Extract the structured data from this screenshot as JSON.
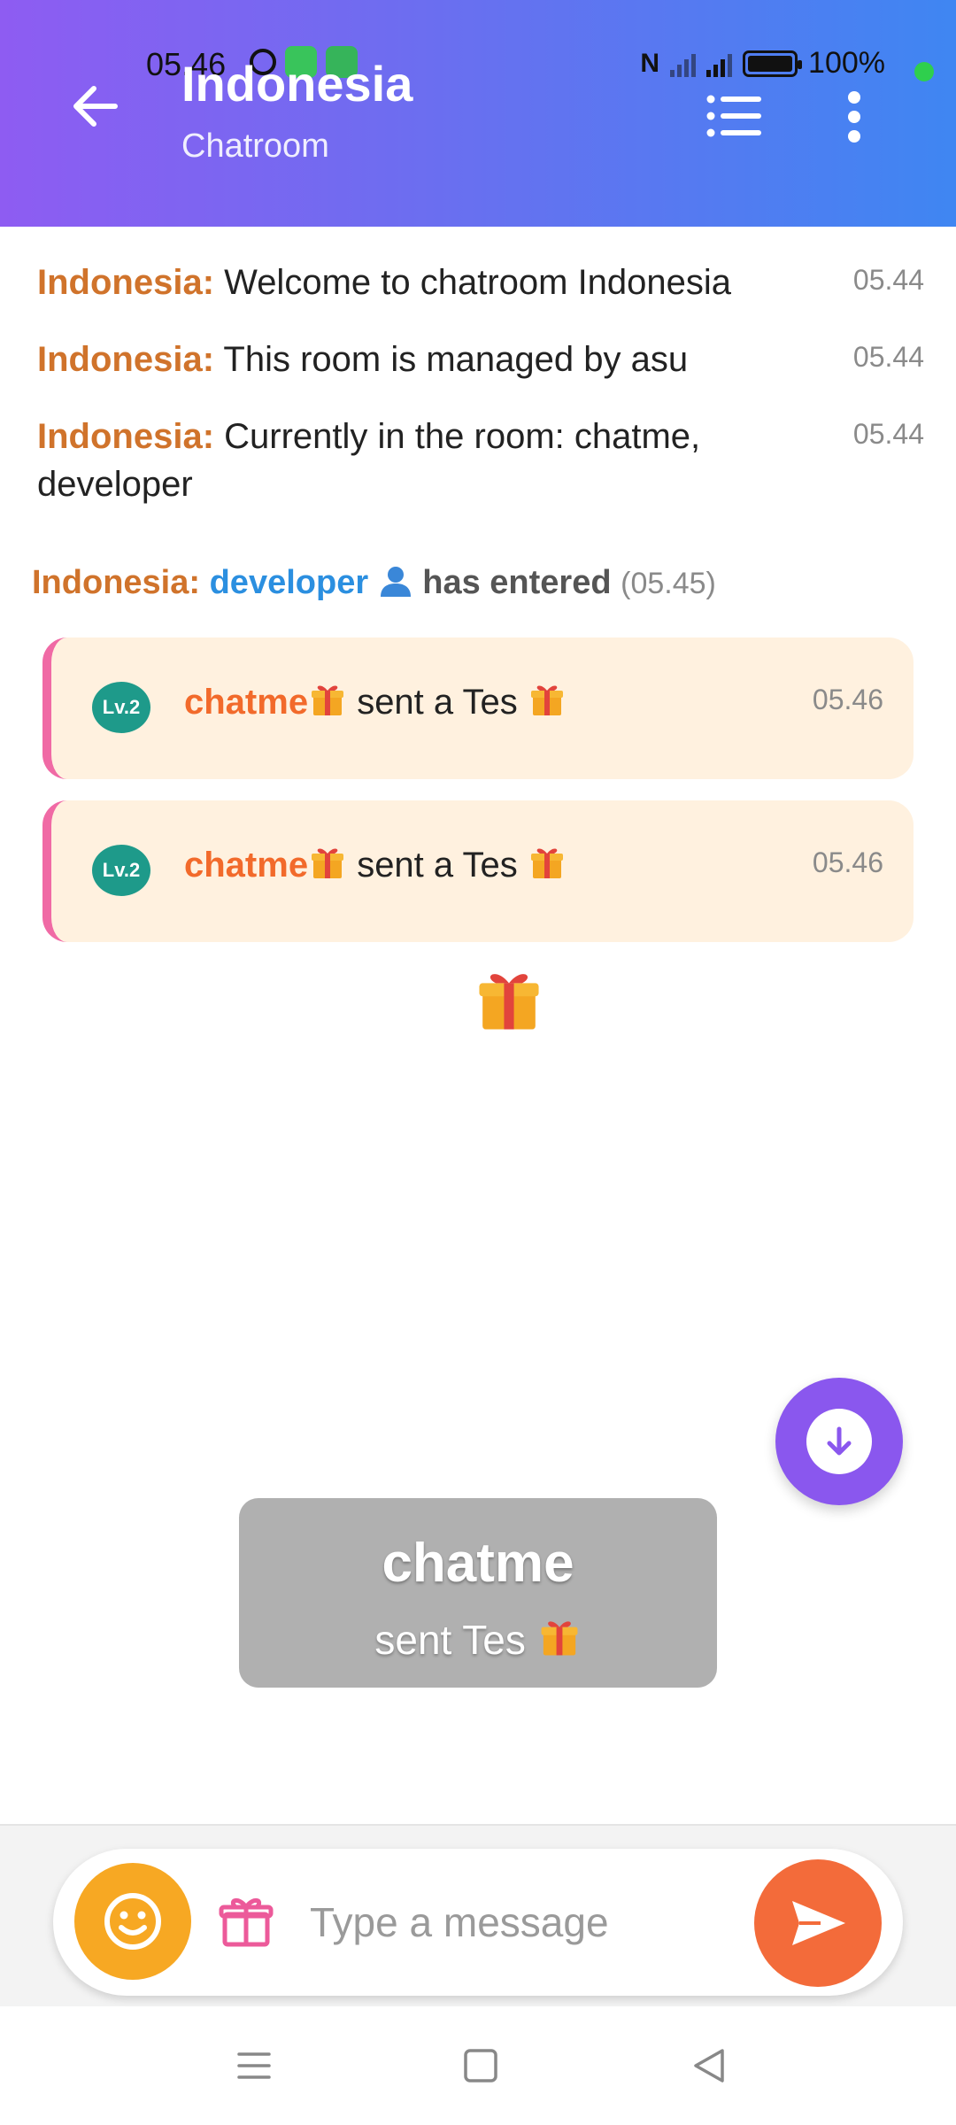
{
  "status_bar": {
    "time": "05.46",
    "battery": "100%"
  },
  "header": {
    "title": "Indonesia",
    "subtitle": "Chatroom"
  },
  "messages": [
    {
      "sender": "Indonesia:",
      "text": "Welcome to chatroom Indonesia",
      "time": "05.44"
    },
    {
      "sender": "Indonesia:",
      "text": "This room is managed by asu",
      "time": "05.44"
    },
    {
      "sender": "Indonesia:",
      "text": "Currently in the room: chatme, developer",
      "time": "05.44"
    }
  ],
  "entered": {
    "sender": "Indonesia:",
    "user": "developer",
    "action": "has entered",
    "time": "(05.45)"
  },
  "gift_cards": [
    {
      "level": "Lv.2",
      "sender": "chatme",
      "text": "sent a Tes",
      "time": "05.46"
    },
    {
      "level": "Lv.2",
      "sender": "chatme",
      "text": "sent a Tes",
      "time": "05.46"
    }
  ],
  "toast": {
    "name": "chatme",
    "text": "sent Tes"
  },
  "input": {
    "placeholder": "Type a message"
  },
  "colors": {
    "header_start": "#8e5cf2",
    "header_end": "#3f86f2",
    "sender": "#d0732b",
    "gift_sender": "#f26a2b",
    "user_link": "#2b8fe0",
    "emoji_button": "#f7a823",
    "send_button": "#f36b3a",
    "scroll_button": "#8a57ee",
    "card_bg": "#fff1df",
    "card_accent": "#f06aa5"
  }
}
